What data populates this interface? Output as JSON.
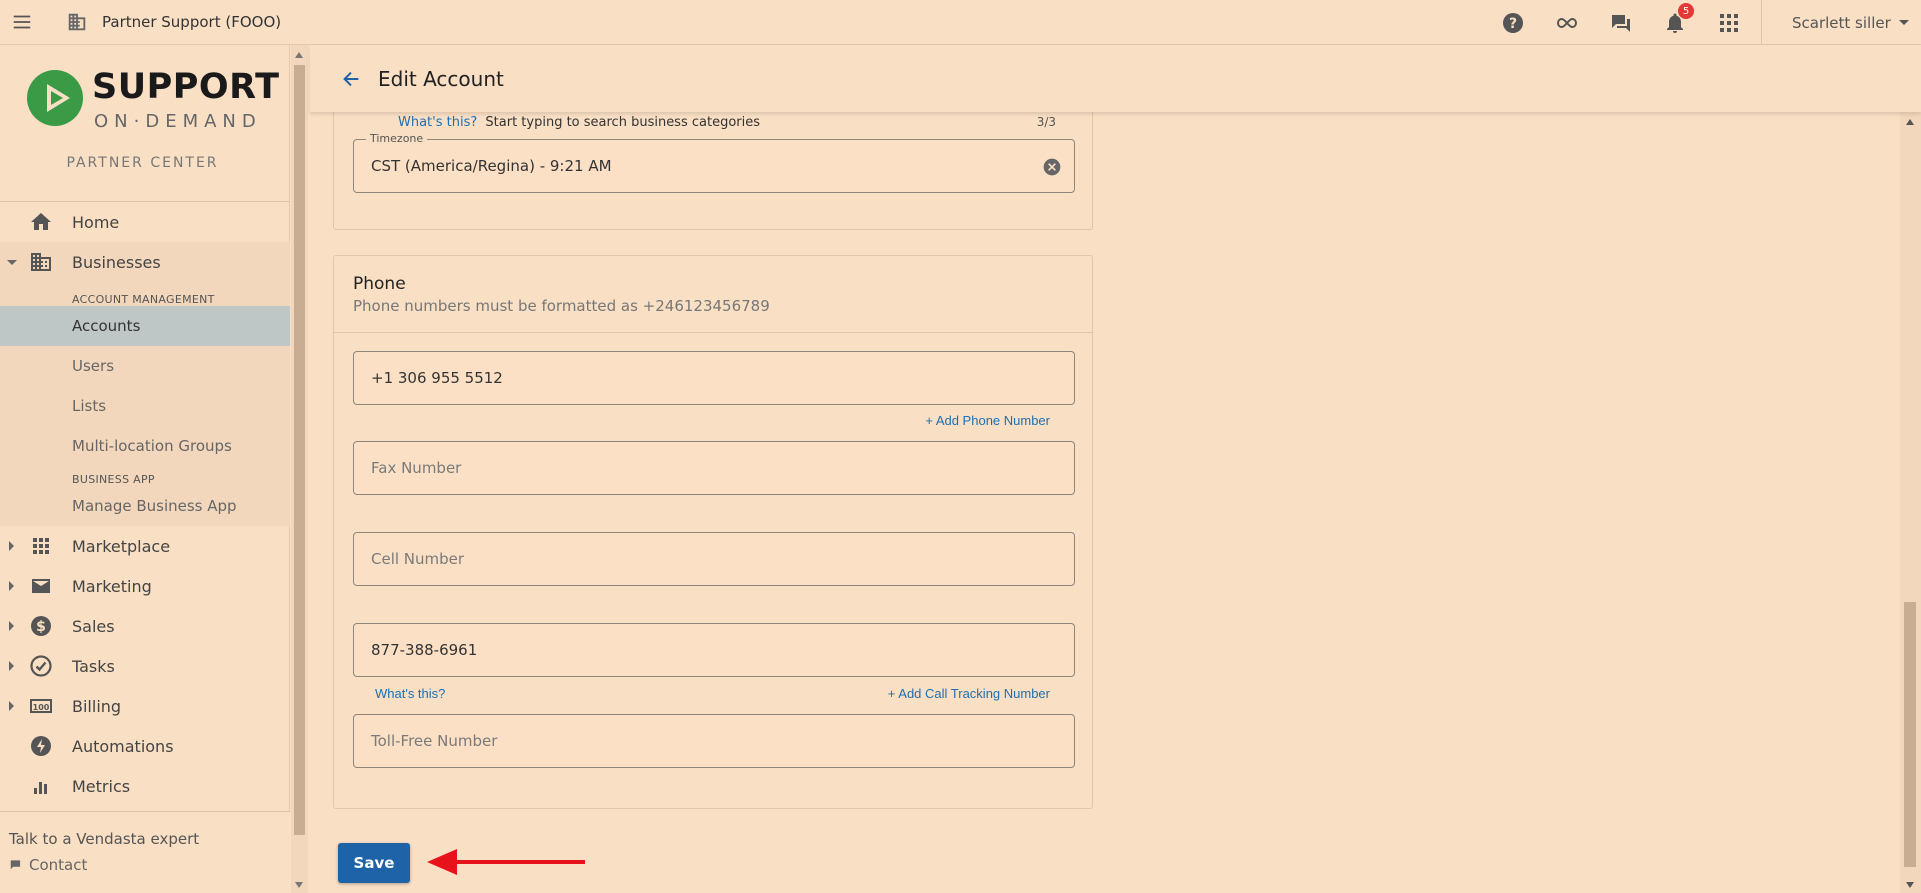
{
  "topbar": {
    "org_title": "Partner Support (FOOO)",
    "notification_count": "5",
    "user_name": "Scarlett siller"
  },
  "logo": {
    "line1": "SUPPORT",
    "line2": "ON·DEMAND",
    "partner_center": "PARTNER CENTER"
  },
  "nav": {
    "home": "Home",
    "businesses": "Businesses",
    "account_management": "ACCOUNT MANAGEMENT",
    "accounts": "Accounts",
    "users": "Users",
    "lists": "Lists",
    "multi_location": "Multi-location Groups",
    "business_app_header": "BUSINESS APP",
    "manage_business_app": "Manage Business App",
    "marketplace": "Marketplace",
    "marketing": "Marketing",
    "sales": "Sales",
    "tasks": "Tasks",
    "billing": "Billing",
    "automations": "Automations",
    "metrics": "Metrics"
  },
  "footer": {
    "talk": "Talk to a Vendasta expert",
    "contact": "Contact"
  },
  "page": {
    "title": "Edit Account"
  },
  "categories": {
    "whats_this": "What's this?",
    "hint": "Start typing to search business categories",
    "count": "3/3"
  },
  "timezone": {
    "label": "Timezone",
    "value": "CST (America/Regina) - 9:21 AM"
  },
  "phone": {
    "title": "Phone",
    "subtitle": "Phone numbers must be formatted as +246123456789",
    "work_value": "+1 306 955 5512",
    "add_phone": "+ Add Phone Number",
    "fax_placeholder": "Fax Number",
    "cell_placeholder": "Cell Number",
    "call_tracking_value": "877-388-6961",
    "whats_this": "What's this?",
    "add_call_tracking": "+ Add Call Tracking Number",
    "toll_free_placeholder": "Toll-Free Number"
  },
  "actions": {
    "save": "Save"
  },
  "colors": {
    "accent": "#1e63a7",
    "link": "#1e6fb3",
    "background": "#f9dfc4",
    "active_nav": "#bfc7c6",
    "badge": "#e53935",
    "annotation_arrow": "#e8121b"
  }
}
